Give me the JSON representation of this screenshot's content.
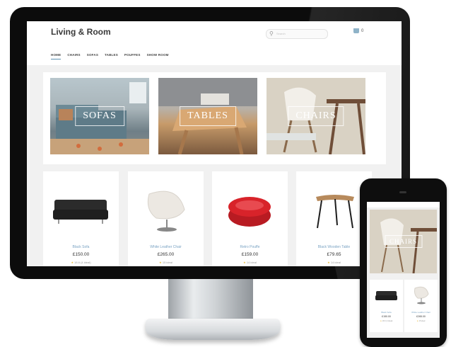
{
  "site": {
    "logo": "Living & Room",
    "search_placeholder": "Search",
    "cart_count": "0",
    "nav": [
      "HOME",
      "CHAIRS",
      "SOFAS",
      "TABLES",
      "POUFFES",
      "SHOW ROOM"
    ]
  },
  "banners": [
    {
      "label": "SOFAS"
    },
    {
      "label": "TABLES"
    },
    {
      "label": "CHAIRS"
    }
  ],
  "products": [
    {
      "name": "Black Sofa",
      "price": "£150.00",
      "rating": "18.6 (4 ideal)"
    },
    {
      "name": "White Leather Chair",
      "price": "£265.00",
      "rating": "15 ideal"
    },
    {
      "name": "Retro Pouffe",
      "price": "£159.00",
      "rating": "14 ideal"
    },
    {
      "name": "Black Wooden Table",
      "price": "£79.65",
      "rating": "14 ideal"
    }
  ],
  "mobile": {
    "banner": {
      "label": "CHAIRS"
    },
    "products": [
      {
        "name": "Black Sofa",
        "price": "£150.00",
        "rating": "18.6 (4 ideal)"
      },
      {
        "name": "White Leather Chair",
        "price": "£265.00",
        "rating": "15 ideal"
      }
    ]
  },
  "colors": {
    "accent": "#7aa3c3",
    "star": "#e8b93a",
    "pouffe_red": "#d8232a"
  }
}
